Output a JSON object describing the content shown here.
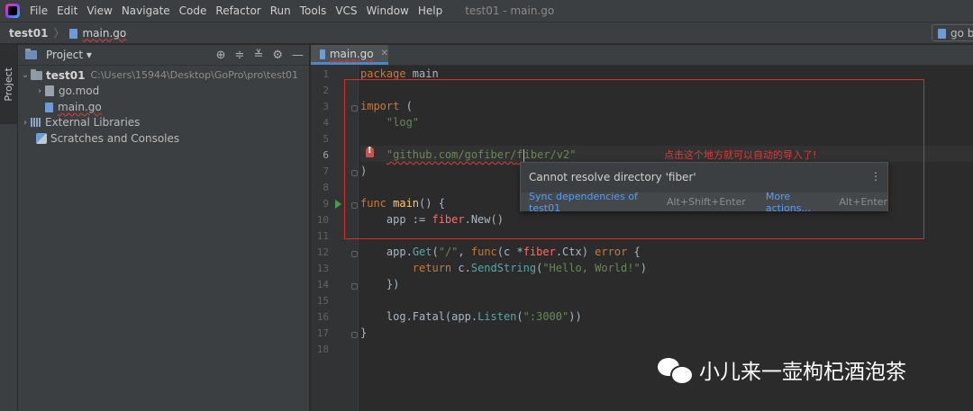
{
  "menu": {
    "items": [
      "File",
      "Edit",
      "View",
      "Navigate",
      "Code",
      "Refactor",
      "Run",
      "Tools",
      "VCS",
      "Window",
      "Help"
    ],
    "window_title": "test01 - main.go"
  },
  "navbar": {
    "project": "test01",
    "file": "main.go",
    "run_config": "go b"
  },
  "left_strip": {
    "label": "Project"
  },
  "project_panel": {
    "title": "Project ▾",
    "tree": {
      "root_name": "test01",
      "root_path": "C:\\Users\\15944\\Desktop\\GoPro\\pro\\test01",
      "go_mod": "go.mod",
      "main_go": "main.go",
      "external_libraries": "External Libraries",
      "scratches": "Scratches and Consoles"
    }
  },
  "editor": {
    "tab": "main.go",
    "line_numbers": [
      "1",
      "2",
      "3",
      "4",
      "5",
      "6",
      "7",
      "8",
      "9",
      "10",
      "11",
      "12",
      "13",
      "14",
      "15",
      "16",
      "17",
      "18"
    ],
    "code": {
      "l1_kw": "package",
      "l1_name": " main",
      "l3_kw": "import",
      "l3_rest": " (",
      "l4_str": "\"log\"",
      "l6_a": "\"github.com/gofiber/",
      "l6_b": "f",
      "l6_c": "iber/v2\"",
      "l7": ")",
      "l9_kw": "func",
      "l9_fn": " main",
      "l9_rest": "() {",
      "l10_a": "app := ",
      "l10_pkg": "fiber",
      "l10_rest": ".New()",
      "l12_a": "app.",
      "l12_call": "Get",
      "l12_b": "(",
      "l12_str": "\"/\"",
      "l12_c": ", ",
      "l12_kw": "func",
      "l12_d": "(c *",
      "l12_pkg": "fiber",
      "l12_e": ".Ctx) ",
      "l12_kw2": "error",
      "l12_f": " {",
      "l13_kw": "return",
      "l13_a": " c.",
      "l13_call": "SendString",
      "l13_b": "(",
      "l13_str": "\"Hello, World!\"",
      "l13_c": ")",
      "l14": "})",
      "l16_a": "log.Fatal(app.",
      "l16_call": "Listen",
      "l16_b": "(",
      "l16_str": "\":3000\"",
      "l16_c": "))",
      "l17": "}"
    },
    "annotation": "点击这个地方就可以自动的导入了!"
  },
  "popup": {
    "message": "Cannot resolve directory 'fiber'",
    "menu_icon": "⋮",
    "action1": "Sync dependencies of test01",
    "action1_shortcut": "Alt+Shift+Enter",
    "action2": "More actions...",
    "action2_shortcut": "Alt+Enter"
  },
  "watermark": {
    "text": "小儿来一壶枸杞酒泡茶"
  }
}
